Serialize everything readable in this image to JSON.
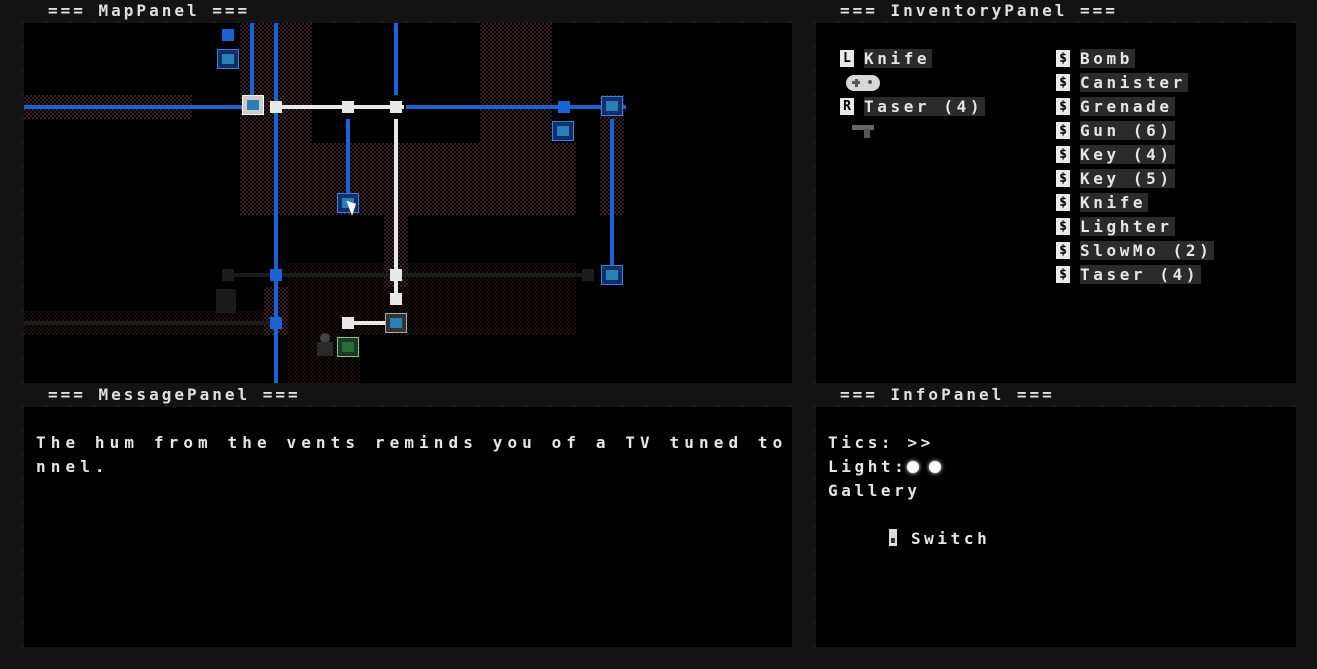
{
  "titles": {
    "map": "=== MapPanel ===",
    "inventory": "=== InventoryPanel ===",
    "message": "=== MessagePanel ===",
    "info": "=== InfoPanel ==="
  },
  "inventory": {
    "equipped": [
      {
        "slot": "L",
        "name": "Knife",
        "icon": "gamepad-icon"
      },
      {
        "slot": "R",
        "name": "Taser (4)",
        "icon": "taser-icon"
      }
    ],
    "store": [
      {
        "tag": "$",
        "name": "Bomb"
      },
      {
        "tag": "$",
        "name": "Canister"
      },
      {
        "tag": "$",
        "name": "Grenade"
      },
      {
        "tag": "$",
        "name": "Gun (6)"
      },
      {
        "tag": "$",
        "name": "Key (4)"
      },
      {
        "tag": "$",
        "name": "Key (5)"
      },
      {
        "tag": "$",
        "name": "Knife"
      },
      {
        "tag": "$",
        "name": "Lighter"
      },
      {
        "tag": "$",
        "name": "SlowMo (2)"
      },
      {
        "tag": "$",
        "name": "Taser (4)"
      }
    ]
  },
  "message": {
    "line1": "The hum from the vents reminds you of a TV tuned to a dead cha",
    "line2": "nnel."
  },
  "info": {
    "tics": "Tics: >>",
    "light_label": "Light:",
    "light_count": 2,
    "location": "Gallery",
    "switch_label": "Switch"
  },
  "colors": {
    "wire": "#1a63d6",
    "wire_active": "#e8e8e8",
    "floor": "#3a1f22",
    "panel_bg": "#000000",
    "window_bg": "#131313"
  }
}
